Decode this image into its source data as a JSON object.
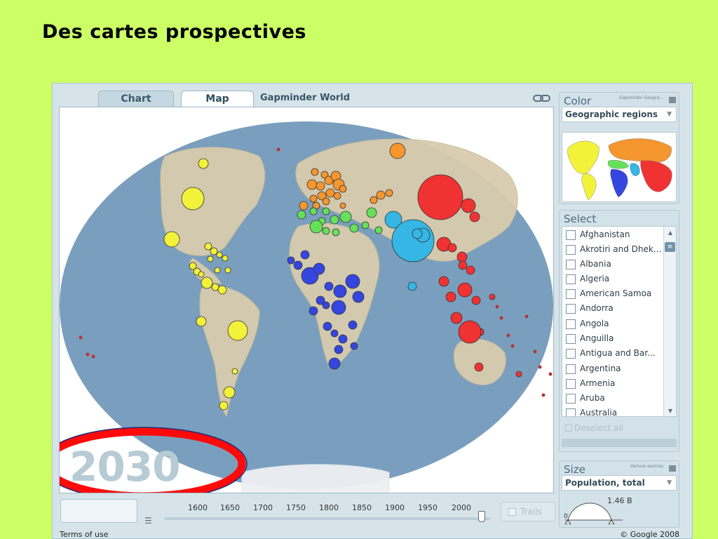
{
  "slide": {
    "title": "Des cartes prospectives"
  },
  "app": {
    "tabs": [
      {
        "label": "Chart"
      },
      {
        "label": "Map"
      }
    ],
    "title": "Gapminder World",
    "year": "2030",
    "footer_left": "Terms of use",
    "footer_right": "© Google 2008"
  },
  "timeline": {
    "ticks": [
      "1600",
      "1650",
      "1700",
      "1750",
      "1800",
      "1850",
      "1900",
      "1950",
      "2000"
    ],
    "trails_label": "Trails",
    "current_year": 2030
  },
  "color_panel": {
    "heading": "Color",
    "source": "Gapminder Geogra...",
    "selected": "Geographic regions"
  },
  "select_panel": {
    "heading": "Select",
    "countries": [
      "Afghanistan",
      "Akrotiri and Dhek...",
      "Albania",
      "Algeria",
      "American Samoa",
      "Andorra",
      "Angola",
      "Anguilla",
      "Antigua and Bar...",
      "Argentina",
      "Armenia",
      "Aruba",
      "Australia"
    ],
    "deselect_label": "Deselect all"
  },
  "size_panel": {
    "heading": "Size",
    "source": "Various sources",
    "selected": "Population, total",
    "max_value": "1.46 B",
    "min_value": "0"
  },
  "colors": {
    "background": "#ccff66",
    "ocean": "#7a9fbe",
    "america": "#f2f23a",
    "europe_central_asia": "#f5962f",
    "middle_east_north_africa": "#66e05a",
    "sub_saharan_africa": "#3546e0",
    "south_asia": "#35b6e4",
    "east_asia_pacific": "#f03232",
    "highlight_ellipse": "#ff0a0a"
  }
}
